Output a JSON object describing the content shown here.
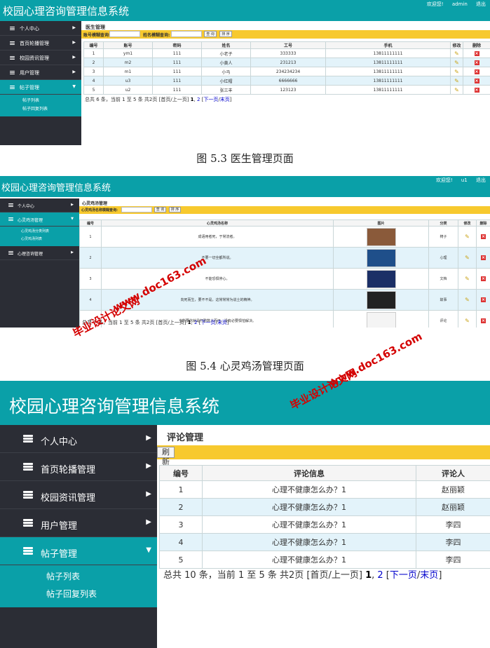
{
  "shot1": {
    "title": "校园心理咨询管理信息系统",
    "top_links": [
      "欢迎您!",
      "admin",
      "退出"
    ],
    "menu": [
      {
        "label": "个人中心"
      },
      {
        "label": "首页轮播管理"
      },
      {
        "label": "校园资讯管理"
      },
      {
        "label": "用户管理"
      },
      {
        "label": "帖子管理",
        "active": true
      }
    ],
    "submenu": [
      "帖子列表",
      "帖子回复列表"
    ],
    "page_title": "医生管理",
    "search": {
      "label1": "账号模糊查询:",
      "label2": "姓名模糊查询:",
      "query_btn": "查 询",
      "sort_btn": "排 序"
    },
    "columns": [
      "编号",
      "账号",
      "密码",
      "姓名",
      "工号",
      "手机",
      "修改",
      "删除"
    ],
    "rows": [
      [
        "1",
        "ym1",
        "111",
        "小老子",
        "333333",
        "13811111111"
      ],
      [
        "2",
        "m2",
        "111",
        "小黄人",
        "231213",
        "13811111111"
      ],
      [
        "3",
        "m1",
        "111",
        "小马",
        "234234234",
        "13811111111"
      ],
      [
        "4",
        "u3",
        "111",
        "小红帽",
        "6666666",
        "13811111111"
      ],
      [
        "5",
        "u2",
        "111",
        "张三丰",
        "123123",
        "13811111111"
      ]
    ],
    "footer": {
      "text": "总共 6 条，当前 1 至 5 条 共2页 [首页/上一页]",
      "p1": "1",
      "p2": "2",
      "next": "下一页",
      "last": "末页"
    }
  },
  "caption1": "图 5.3 医生管理页面",
  "shot2": {
    "title": "校园心理咨询管理信息系统",
    "top_links": [
      "欢迎您!",
      "u1",
      "退出"
    ],
    "menu": [
      {
        "label": "个人中心"
      },
      {
        "label": "心灵鸡汤管理",
        "active": true
      },
      {
        "label": "心理咨询管理"
      }
    ],
    "submenu": [
      "心灵鸡汤分类列表",
      "心灵鸡汤列表"
    ],
    "page_title": "心灵鸡汤管理",
    "search": {
      "label1": "心灵鸡汤名称模糊查询:",
      "query_btn": "查 询",
      "sort_btn": "排 序"
    },
    "columns": [
      "编号",
      "心灵鸡汤名称",
      "图片",
      "分类",
      "修改",
      "删除"
    ],
    "rows": [
      [
        "1",
        "成语用者死，于常流者。",
        "椅子"
      ],
      [
        "2",
        "不要一切全都所说。",
        "心理"
      ],
      [
        "3",
        "不能恐惧停心。",
        "文档"
      ],
      [
        "4",
        "向死而生，要不不是，这常常常为说士的精神。",
        "故事"
      ],
      [
        "5",
        "当所要信就是打勤数人而已，没有必要惧怕解决。",
        "评论"
      ]
    ],
    "image_colors": [
      "#8a5a3a",
      "#1f4f8a",
      "#1b2f66",
      "#222222",
      "#f4f4f4"
    ],
    "footer": {
      "text": "总共 7 条，当前 1 至 5 条 共2页 [首页/上一页]",
      "p1": "1",
      "p2": "2",
      "next": "下一页",
      "last": "末页"
    }
  },
  "caption2": "图 5.4 心灵鸡汤管理页面",
  "shot3": {
    "title": "校园心理咨询管理信息系统",
    "menu": [
      {
        "label": "个人中心"
      },
      {
        "label": "首页轮播管理"
      },
      {
        "label": "校园资讯管理"
      },
      {
        "label": "用户管理"
      },
      {
        "label": "帖子管理",
        "active": true
      }
    ],
    "submenu": [
      "帖子列表",
      "帖子回复列表"
    ],
    "page_title": "评论管理",
    "refresh_btn": "刷 新",
    "columns": [
      "编号",
      "评论信息",
      "评论人"
    ],
    "rows": [
      [
        "1",
        "心理不健康怎么办？1",
        "赵丽颖"
      ],
      [
        "2",
        "心理不健康怎么办？1",
        "赵丽颖"
      ],
      [
        "3",
        "心理不健康怎么办？1",
        "李四"
      ],
      [
        "4",
        "心理不健康怎么办？1",
        "李四"
      ],
      [
        "5",
        "心理不健康怎么办？1",
        "李四"
      ]
    ],
    "footer": {
      "text": "总共 10 条，当前 1 至 5 条 共2页 [首页/上一页]",
      "p1": "1",
      "p2": "2",
      "next": "下一页",
      "last": "末页"
    }
  },
  "watermarks": [
    "毕业设计论文网",
    "www.doc163.com",
    "毕业设计论文网",
    "www.doc163.com"
  ],
  "colors": {
    "teal": "#0aa0a8",
    "sidebar": "#2b2d35",
    "toolbar": "#f7c92e",
    "row_alt": "#e3f3fa",
    "delete": "#dd3333"
  }
}
